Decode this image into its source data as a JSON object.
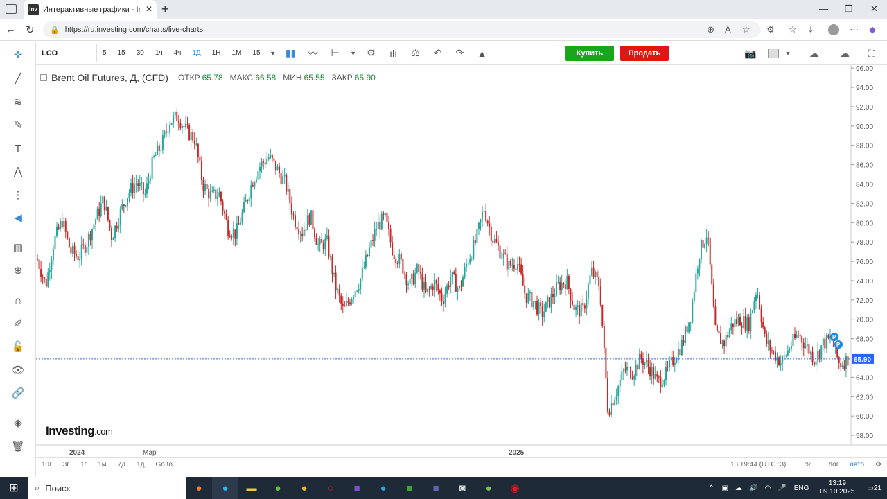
{
  "browser": {
    "tab_title": "Интерактивные графики - Invest",
    "favicon_text": "Inv",
    "url": "https://ru.investing.com/charts/live-charts"
  },
  "toolbar": {
    "symbol": "LCO",
    "intervals": [
      "5",
      "15",
      "30",
      "1ч",
      "4ч",
      "1Д",
      "1Н",
      "1М",
      "15"
    ],
    "active_interval": "1Д",
    "buy_label": "Купить",
    "sell_label": "Продать"
  },
  "legend": {
    "title": "Brent Oil Futures, Д, (CFD)",
    "open_label": "ОТКР",
    "open": "65.78",
    "high_label": "МАКС",
    "high": "66.58",
    "low_label": "МИН",
    "low": "65.55",
    "close_label": "ЗАКР",
    "close": "65.90"
  },
  "logo": {
    "main": "Investing",
    "suffix": ".com"
  },
  "bottom": {
    "ranges": [
      "10г",
      "3г",
      "1г",
      "1м",
      "7д",
      "1д"
    ],
    "goto": "Go to...",
    "time": "13:19:44 (UTC+3)",
    "percent": "%",
    "log": "лог",
    "auto": "авто"
  },
  "taskbar": {
    "search_placeholder": "Поиск",
    "lang": "ENG",
    "time": "13:19",
    "date": "09.10.2025",
    "notifications": "21"
  },
  "colors": {
    "up": "#26a69a",
    "down": "#c62828",
    "price_label": "#2962ff",
    "buy": "#1aa51a",
    "sell": "#e01616"
  },
  "chart_data": {
    "type": "candlestick",
    "title": "Brent Oil Futures, Д, (CFD)",
    "y_ticks": [
      58,
      60,
      62,
      64,
      66,
      68,
      70,
      72,
      74,
      76,
      78,
      80,
      82,
      84,
      86,
      88,
      90,
      92,
      94,
      96
    ],
    "ylim": [
      57,
      96.3
    ],
    "x_labels": [
      "2024",
      "Мар",
      "2025"
    ],
    "last_price": "65.90",
    "markers": [
      "P",
      "P"
    ],
    "close_series": [
      76.2,
      73.5,
      78.1,
      80.2,
      77.0,
      76.5,
      78.0,
      80.3,
      82.4,
      78.5,
      81.0,
      83.1,
      84.2,
      82.8,
      86.5,
      88.0,
      90.5,
      91.0,
      89.5,
      88.7,
      84.0,
      82.7,
      83.0,
      79.5,
      78.8,
      81.5,
      84.3,
      86.0,
      86.8,
      85.5,
      84.0,
      80.5,
      79.0,
      80.8,
      77.5,
      78.0,
      73.5,
      70.8,
      72.5,
      74.0,
      76.8,
      79.5,
      80.5,
      77.0,
      75.8,
      73.5,
      75.2,
      72.5,
      73.8,
      72.0,
      74.5,
      73.0,
      76.0,
      78.0,
      81.5,
      78.5,
      77.0,
      75.5,
      76.0,
      72.5,
      71.8,
      70.5,
      72.0,
      73.5,
      74.0,
      71.0,
      70.9,
      75.0,
      73.5,
      60.5,
      62.5,
      64.8,
      64.5,
      66.0,
      65.0,
      63.5,
      64.3,
      66.0,
      67.5,
      70.5,
      76.8,
      79.0,
      68.5,
      67.5,
      69.5,
      70.0,
      69.4,
      73.3,
      67.8,
      66.5,
      65.5,
      67.2,
      68.5,
      67.2,
      65.8,
      67.5,
      68.0,
      65.3,
      65.9
    ]
  }
}
